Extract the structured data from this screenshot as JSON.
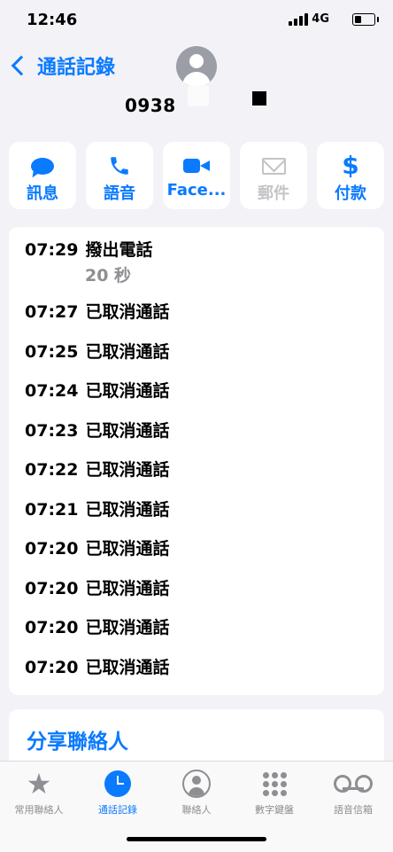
{
  "status_bar": {
    "time": "12:46",
    "network": "4G"
  },
  "header": {
    "back_label": "通話記錄",
    "phone_number": "0938"
  },
  "actions": [
    {
      "label": "訊息",
      "icon": "message-bubble-icon",
      "enabled": true
    },
    {
      "label": "語音",
      "icon": "phone-icon",
      "enabled": true
    },
    {
      "label": "Face...",
      "icon": "video-camera-icon",
      "enabled": true
    },
    {
      "label": "郵件",
      "icon": "envelope-icon",
      "enabled": false
    },
    {
      "label": "付款",
      "icon": "dollar-icon",
      "enabled": true
    }
  ],
  "call_log": [
    {
      "time": "07:29",
      "status": "撥出電話",
      "duration": "20 秒"
    },
    {
      "time": "07:27",
      "status": "已取消通話"
    },
    {
      "time": "07:25",
      "status": "已取消通話"
    },
    {
      "time": "07:24",
      "status": "已取消通話"
    },
    {
      "time": "07:23",
      "status": "已取消通話"
    },
    {
      "time": "07:22",
      "status": "已取消通話"
    },
    {
      "time": "07:21",
      "status": "已取消通話"
    },
    {
      "time": "07:20",
      "status": "已取消通話"
    },
    {
      "time": "07:20",
      "status": "已取消通話"
    },
    {
      "time": "07:20",
      "status": "已取消通話"
    },
    {
      "time": "07:20",
      "status": "已取消通話"
    }
  ],
  "share_contact": "分享聯絡人",
  "tabs": [
    {
      "label": "常用聯絡人",
      "icon": "star-icon"
    },
    {
      "label": "通話記錄",
      "icon": "clock-icon",
      "active": true
    },
    {
      "label": "聯絡人",
      "icon": "person-circle-icon"
    },
    {
      "label": "數字鍵盤",
      "icon": "keypad-icon"
    },
    {
      "label": "語音信箱",
      "icon": "voicemail-icon"
    }
  ],
  "colors": {
    "accent": "#0a7aff",
    "background": "#f2f2f7",
    "disabled": "#c4c4c8",
    "secondary_text": "#8e8e93"
  }
}
